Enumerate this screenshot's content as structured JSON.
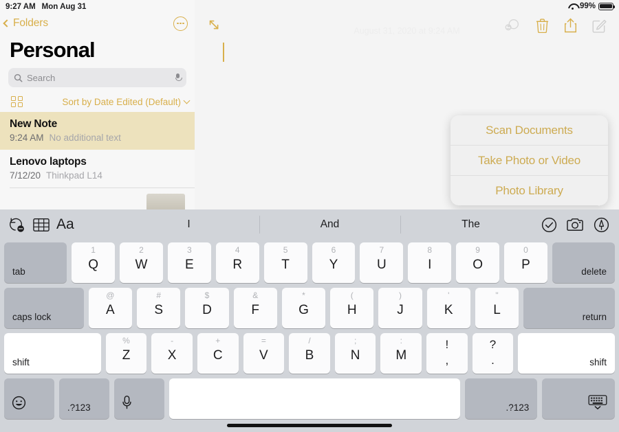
{
  "status_bar": {
    "time": "9:27 AM",
    "date": "Mon Aug 31",
    "battery": "99%",
    "wifi_icon": "wifi-icon",
    "battery_icon": "battery-icon"
  },
  "sidebar": {
    "back_label": "Folders",
    "back_icon": "chevron-left-icon",
    "more_icon": "ellipsis-circle-icon",
    "title": "Personal",
    "search": {
      "placeholder": "Search",
      "value": "",
      "search_icon": "search-icon",
      "mic_icon": "microphone-icon"
    },
    "sort": {
      "grid_icon": "grid-view-icon",
      "label": "Sort by Date Edited (Default)",
      "chevron_icon": "chevron-down-icon"
    },
    "notes": [
      {
        "title": "New Note",
        "date": "9:24 AM",
        "snippet": "No additional text",
        "selected": true
      },
      {
        "title": "Lenovo laptops",
        "date": "7/12/20",
        "snippet": "Thinkpad L14",
        "selected": false
      }
    ]
  },
  "editor": {
    "expand_icon": "expand-diagonal-icon",
    "date_header": "August 31, 2020 at 9:24 AM",
    "actions": [
      {
        "name": "share-collaborate-icon",
        "label": ""
      },
      {
        "name": "trash-icon",
        "label": ""
      },
      {
        "name": "share-icon",
        "label": ""
      },
      {
        "name": "compose-icon",
        "label": ""
      }
    ]
  },
  "popup": {
    "items": [
      {
        "label": "Scan Documents"
      },
      {
        "label": "Take Photo or Video"
      },
      {
        "label": "Photo Library"
      }
    ]
  },
  "keyboard": {
    "toolbar": {
      "undo_icon": "undo-more-icon",
      "table_icon": "table-icon",
      "format_label": "Aa",
      "predictions": [
        "I",
        "And",
        "The"
      ],
      "checklist_icon": "checkmark-circle-icon",
      "camera_icon": "camera-icon",
      "markup_icon": "markup-pen-icon"
    },
    "rows": [
      [
        {
          "main": "tab",
          "style": "gray",
          "align": "bottom-left",
          "flex": 1.45
        },
        {
          "sec": "1",
          "main": "Q",
          "flex": 1
        },
        {
          "sec": "2",
          "main": "W",
          "flex": 1
        },
        {
          "sec": "3",
          "main": "E",
          "flex": 1
        },
        {
          "sec": "4",
          "main": "R",
          "flex": 1
        },
        {
          "sec": "5",
          "main": "T",
          "flex": 1
        },
        {
          "sec": "6",
          "main": "Y",
          "flex": 1
        },
        {
          "sec": "7",
          "main": "U",
          "flex": 1
        },
        {
          "sec": "8",
          "main": "I",
          "flex": 1
        },
        {
          "sec": "9",
          "main": "O",
          "flex": 1
        },
        {
          "sec": "0",
          "main": "P",
          "flex": 1
        },
        {
          "main": "delete",
          "style": "gray",
          "align": "bottom-right",
          "flex": 1.45
        }
      ],
      [
        {
          "main": "caps lock",
          "style": "gray",
          "align": "bottom-left",
          "flex": 1.83
        },
        {
          "sec": "@",
          "main": "A",
          "flex": 1
        },
        {
          "sec": "#",
          "main": "S",
          "flex": 1
        },
        {
          "sec": "$",
          "main": "D",
          "flex": 1
        },
        {
          "sec": "&",
          "main": "F",
          "flex": 1
        },
        {
          "sec": "*",
          "main": "G",
          "flex": 1
        },
        {
          "sec": "(",
          "main": "H",
          "flex": 1
        },
        {
          "sec": ")",
          "main": "J",
          "flex": 1
        },
        {
          "sec": "'",
          "main": "K",
          "flex": 1
        },
        {
          "sec": "\"",
          "main": "L",
          "flex": 1
        },
        {
          "main": "return",
          "style": "gray",
          "align": "bottom-right",
          "flex": 2.1
        }
      ],
      [
        {
          "main": "shift",
          "style": "white",
          "align": "bottom-left",
          "flex": 2.36
        },
        {
          "sec": "%",
          "main": "Z",
          "flex": 1
        },
        {
          "sec": "-",
          "main": "X",
          "flex": 1
        },
        {
          "sec": "+",
          "main": "C",
          "flex": 1
        },
        {
          "sec": "=",
          "main": "V",
          "flex": 1
        },
        {
          "sec": "/",
          "main": "B",
          "flex": 1
        },
        {
          "sec": ";",
          "main": "N",
          "flex": 1
        },
        {
          "sec": ":",
          "main": "M",
          "flex": 1
        },
        {
          "dual_top": "!",
          "dual_bot": ",",
          "flex": 1
        },
        {
          "dual_top": "?",
          "dual_bot": ".",
          "flex": 1
        },
        {
          "main": "shift",
          "style": "white",
          "align": "bottom-right",
          "flex": 2.36
        }
      ],
      [
        {
          "icon": "emoji-icon",
          "style": "gray",
          "align": "bottom-left",
          "flex": 1
        },
        {
          "main": ".?123",
          "style": "gray",
          "align": "bottom-left",
          "flex": 1
        },
        {
          "icon": "microphone-icon",
          "style": "gray",
          "align": "bottom-left",
          "flex": 1
        },
        {
          "main": "",
          "style": "white",
          "flex": 5.8
        },
        {
          "main": ".?123",
          "style": "gray",
          "align": "bottom-right",
          "flex": 1.45
        },
        {
          "icon": "dismiss-keyboard-icon",
          "style": "gray",
          "align": "bottom-right",
          "flex": 1.45
        }
      ]
    ]
  },
  "colors": {
    "accent": "#d8af4a",
    "selected_note_bg": "#ede2bd",
    "keyboard_bg": "#d1d4d9",
    "popup_text": "#cdab52"
  }
}
